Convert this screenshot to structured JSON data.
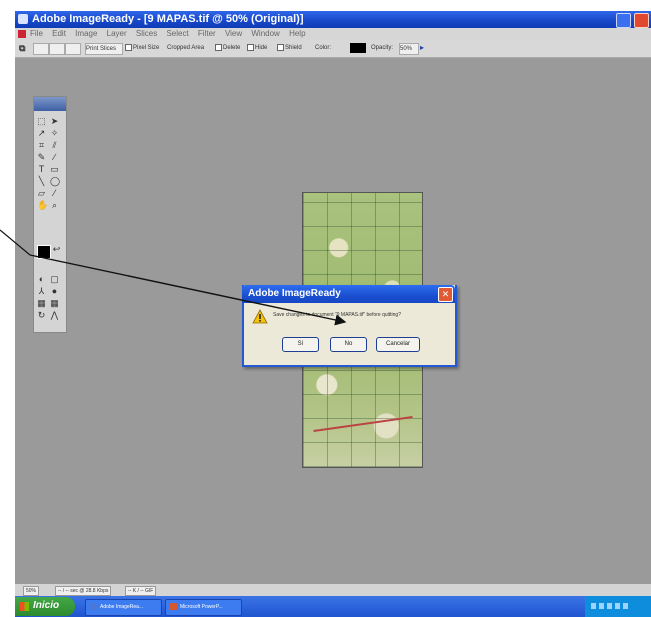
{
  "window": {
    "title": "Adobe ImageReady - [9 MAPAS.tif @ 50% (Original)]"
  },
  "menu": [
    "File",
    "Edit",
    "Image",
    "Layer",
    "Slices",
    "Select",
    "Filter",
    "View",
    "Window",
    "Help"
  ],
  "options_bar": {
    "print_button": "Print Slices",
    "pixel_size": "Pixel Size",
    "cropped_area": "Cropped Area",
    "opt1": "Delete",
    "opt2": "Hide",
    "shield": "Shield",
    "color_label": "Color:",
    "opacity_label": "Opacity:",
    "opacity_value": "50%"
  },
  "dialog": {
    "title": "Adobe ImageReady",
    "message": "Save changes to document \"9 MAPAS.tif\" before quitting?",
    "buttons": [
      "Sí",
      "No",
      "Cancelar"
    ]
  },
  "status": {
    "zoom": "50%",
    "size": "-- / -- sec @ 28.8 Kbps",
    "mode": "-- K / -- GIF"
  },
  "taskbar": {
    "start": "Inicio",
    "tasks": [
      "Adobe ImageRea...",
      "Microsoft PowerP..."
    ]
  },
  "colors": {
    "titlebar": "#1747c9",
    "canvas": "#9a9a9a",
    "taskbar": "#1f55d0",
    "start_button": "#2d8a2f"
  }
}
